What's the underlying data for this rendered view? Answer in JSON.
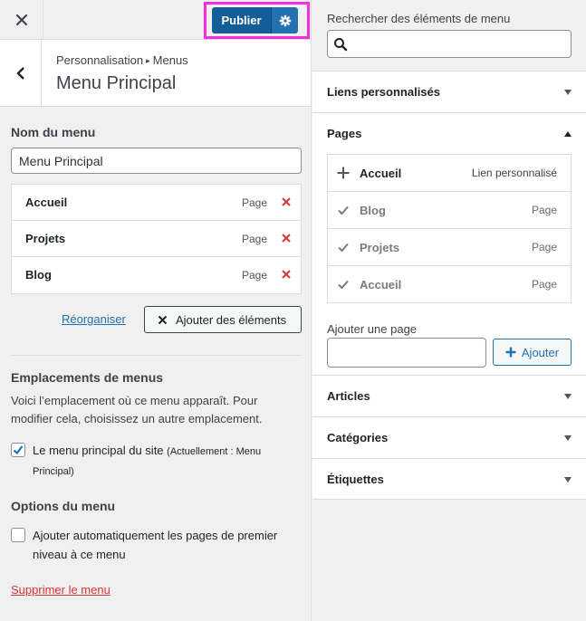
{
  "topbar": {
    "publish_label": "Publier"
  },
  "section": {
    "breadcrumb_parent": "Personnalisation",
    "breadcrumb_current": "Menus",
    "title": "Menu Principal"
  },
  "menu": {
    "name_label": "Nom du menu",
    "name_value": "Menu Principal",
    "items": [
      {
        "title": "Accueil",
        "type": "Page"
      },
      {
        "title": "Projets",
        "type": "Page"
      },
      {
        "title": "Blog",
        "type": "Page"
      }
    ],
    "reorder_label": "Réorganiser",
    "add_items_label": "Ajouter des éléments"
  },
  "locations": {
    "heading": "Emplacements de menus",
    "desc_line1": "Voici l’emplacement où ce menu apparaît. Pour",
    "desc_line2": "modifier cela, choisissez un autre emplacement.",
    "checkbox_label": "Le menu principal du site",
    "checkbox_note_1": "(Actuellement : Menu",
    "checkbox_note_2": "Principal)",
    "checked": true
  },
  "options": {
    "heading": "Options du menu",
    "auto_add_line1": "Ajouter automatiquement les pages de premier",
    "auto_add_line2": "niveau à ce menu",
    "checked": false
  },
  "delete_label": "Supprimer le menu",
  "right": {
    "search_label": "Rechercher des éléments de menu",
    "search_value": "",
    "sections": {
      "custom_links": "Liens personnalisés",
      "pages": "Pages",
      "articles": "Articles",
      "categories": "Catégories",
      "tags": "Étiquettes"
    },
    "pages": [
      {
        "title": "Accueil",
        "type": "Lien personnalisé",
        "state": "add"
      },
      {
        "title": "Blog",
        "type": "Page",
        "state": "added"
      },
      {
        "title": "Projets",
        "type": "Page",
        "state": "added"
      },
      {
        "title": "Accueil",
        "type": "Page",
        "state": "added"
      }
    ],
    "add_page_label": "Ajouter une page",
    "add_page_value": "",
    "add_button_label": "Ajouter"
  },
  "colors": {
    "primary": "#2271b1",
    "primary_dark": "#135e96",
    "danger": "#d63638",
    "highlight": "#f52ee0"
  }
}
